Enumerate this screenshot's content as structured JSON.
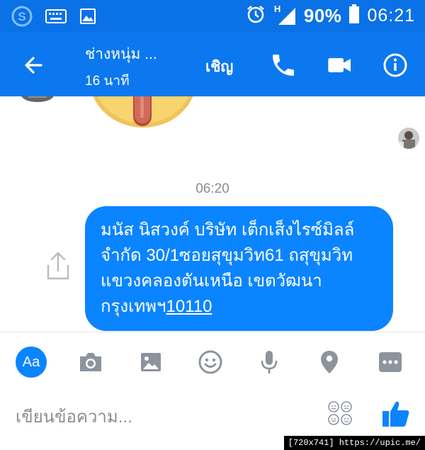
{
  "status_bar": {
    "network_label": "H",
    "battery": "90%",
    "clock": "06:21"
  },
  "header": {
    "contact_name": "ช่างหนุ่ม ...",
    "contact_status": "16 นาที",
    "invite_label": "เชิญ",
    "accent": "#0c78ef"
  },
  "chat": {
    "timestamp": "06:20",
    "message_text": "มนัส นิสวงค์ บริษัท เต็กเส็งไรซ์มิลล์ จำกัด 30/1ซอยสุขุมวิท61 ถสุขุมวิท แขวงคลองตันเหนือ เขตวัฒนา กรุงเทพฯ",
    "message_link": "10110",
    "bubble_color": "#0b84ff"
  },
  "composer": {
    "aa_label": "Aa",
    "placeholder": "เขียนข้อความ..."
  },
  "watermark": "[720x741] https://upic.me/"
}
